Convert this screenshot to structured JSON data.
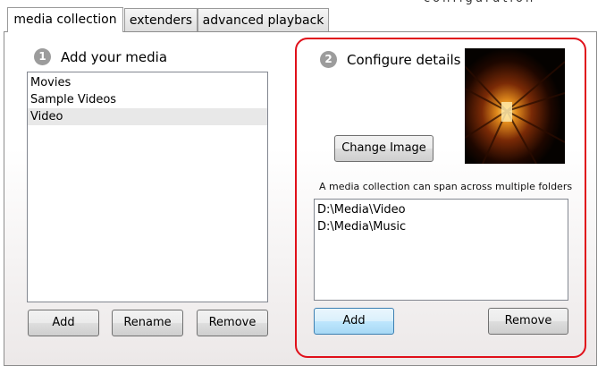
{
  "app": {
    "title": "configuration"
  },
  "tabs": [
    {
      "label": "media collection",
      "active": true
    },
    {
      "label": "extenders",
      "active": false
    },
    {
      "label": "advanced playback",
      "active": false
    }
  ],
  "left_panel": {
    "step_number": "1",
    "heading": "Add your media",
    "items": [
      "Movies",
      "Sample Videos",
      "Video"
    ],
    "selected_item": "Video",
    "buttons": {
      "add": "Add",
      "rename": "Rename",
      "remove": "Remove"
    }
  },
  "right_panel": {
    "step_number": "2",
    "heading": "Configure details",
    "change_image_label": "Change Image",
    "caption": "A media collection can span across multiple folders",
    "folders": [
      "D:\\Media\\Video",
      "D:\\Media\\Music"
    ],
    "buttons": {
      "add": "Add",
      "remove": "Remove"
    }
  },
  "colors": {
    "highlight_frame": "#e0101a",
    "selection": "#e8e8e8",
    "focused_button": "#3c7fb1"
  },
  "icons": {
    "preview_image": "movie-theater-image"
  }
}
